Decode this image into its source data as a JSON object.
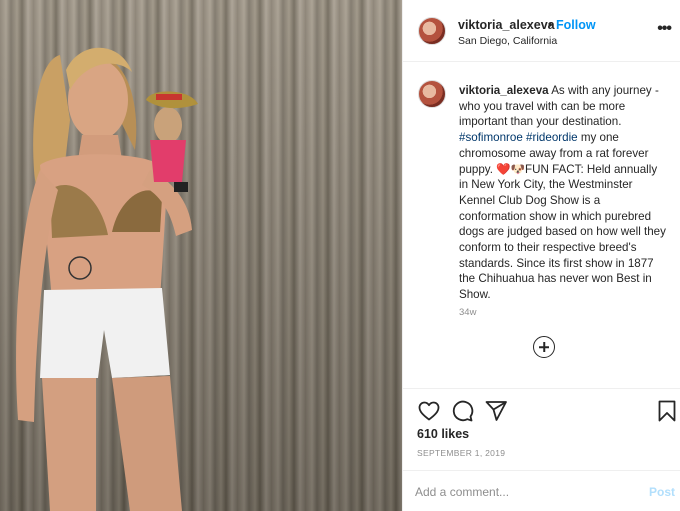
{
  "post": {
    "username": "viktoria_alexeva",
    "separator": "•",
    "follow_label": "Follow",
    "location": "San Diego, California",
    "more_icon": "more-options-icon",
    "more_glyph": "•••"
  },
  "caption": {
    "username": "viktoria_alexeva",
    "text_part1": " As with any journey - who you travel with can be more important than your destination. ",
    "hashtag1": "#sofimonroe",
    "space": " ",
    "hashtag2": "#rideordie",
    "text_part2": " my one chromosome away from a rat forever puppy. ",
    "heart_emoji": "❤️",
    "dog_emoji": "🐶",
    "text_part3": "FUN FACT: Held annually in New York City, the Westminster Kennel Club Dog Show is a conformation show in which purebred dogs are judged based on how well they conform to their respective breed's standards. Since its first show in 1877 the Chihuahua has never won Best in Show.",
    "age": "34w"
  },
  "actions": {
    "like_icon": "heart-icon",
    "comment_icon": "comment-icon",
    "share_icon": "share-icon",
    "save_icon": "bookmark-icon"
  },
  "likes": "610 likes",
  "date": "SEPTEMBER 1, 2019",
  "comment": {
    "placeholder": "Add a comment...",
    "value": "",
    "post_label": "Post"
  },
  "colors": {
    "accent": "#0095f6",
    "post_disabled": "#b2dffc",
    "hashtag": "#00376b",
    "muted": "#8e8e8e"
  }
}
